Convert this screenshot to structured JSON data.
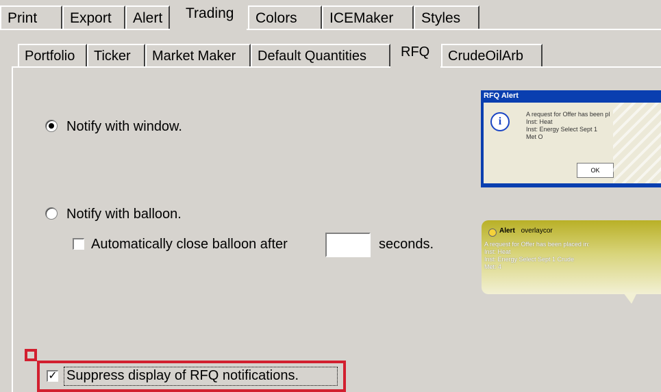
{
  "top_tabs": [
    {
      "label": "Print"
    },
    {
      "label": "Export"
    },
    {
      "label": "Alert"
    },
    {
      "label": "Trading",
      "active": true
    },
    {
      "label": "Colors"
    },
    {
      "label": "ICEMaker"
    },
    {
      "label": "Styles"
    }
  ],
  "inner_tabs": [
    {
      "label": "Portfolio"
    },
    {
      "label": "Ticker"
    },
    {
      "label": "Market Maker"
    },
    {
      "label": "Default Quantities"
    },
    {
      "label": "RFQ",
      "active": true
    },
    {
      "label": "CrudeOilArb"
    }
  ],
  "rfq": {
    "notify_window_label": "Notify with window.",
    "notify_window_selected": true,
    "notify_balloon_label": "Notify with balloon.",
    "notify_balloon_selected": false,
    "auto_close_label": "Automatically close balloon after",
    "auto_close_checked": false,
    "auto_close_value": "",
    "seconds_label": "seconds.",
    "suppress_label": "Suppress display of RFQ notifications.",
    "suppress_checked": true
  },
  "alert_preview": {
    "title": "RFQ Alert",
    "icon": "info-icon",
    "text": "A request for Offer has been pl\nInst: Heat\nInst: Energy Select Sept 1\nMet O",
    "ok_label": "OK"
  },
  "balloon_preview": {
    "title": "Alert",
    "subtitle": "overlaycor",
    "text": "A request for Offer has been placed in:\nInst: Heat\nInst: Energy Select Sept 1 Crude\nMet: 4"
  },
  "colors": {
    "background": "#d6d3ce",
    "highlight": "#d21f2f",
    "alert_titlebar": "#0a3fb0"
  }
}
